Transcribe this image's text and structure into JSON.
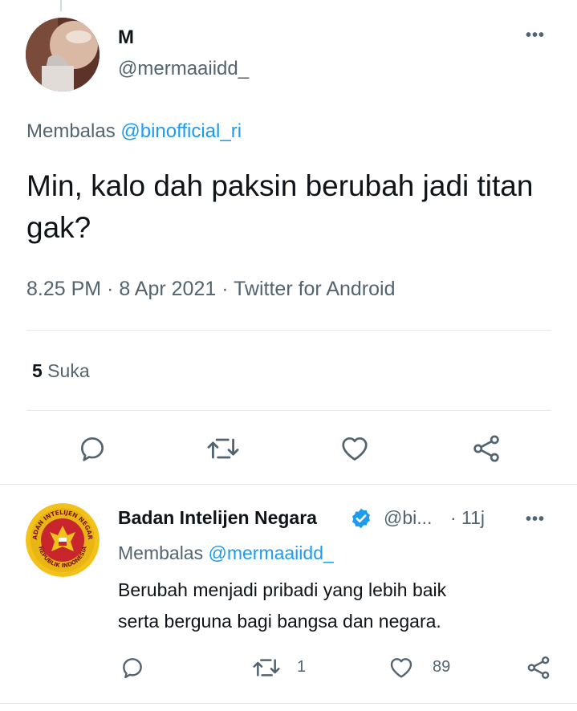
{
  "tweet": {
    "author_name": "M",
    "author_handle": "@mermaaiidd_",
    "replying_prefix": "Membalas ",
    "replying_to": "@binofficial_ri",
    "text": "Min, kalo dah paksin berubah jadi titan gak?",
    "timestamp": "8.25 PM · 8 Apr 2021 · Twitter for Android",
    "likes_count": "5",
    "likes_label": " Suka",
    "more_label": "•••"
  },
  "reply": {
    "author_name": "Badan Intelijen Negara",
    "author_handle": "@bi...",
    "time": "· 11j",
    "replying_prefix": "Membalas ",
    "replying_to": "@mermaaiidd_",
    "text_line1": "Berubah menjadi pribadi yang lebih baik",
    "text_line2": "serta berguna bagi bangsa dan negara.",
    "retweet_count": "1",
    "like_count": "89",
    "more_label": "•••",
    "logo_text_top": "BADAN INTELIJEN NEGARA",
    "logo_text_bottom": "REPUBLIK INDONESIA"
  },
  "colors": {
    "link": "#1d9bf0",
    "muted": "#536471",
    "text": "#0f1419",
    "logo_gold": "#f2c21b",
    "logo_red": "#c8252c"
  },
  "icons": [
    "reply-icon",
    "retweet-icon",
    "like-icon",
    "share-icon",
    "verified-badge-icon",
    "more-icon"
  ]
}
